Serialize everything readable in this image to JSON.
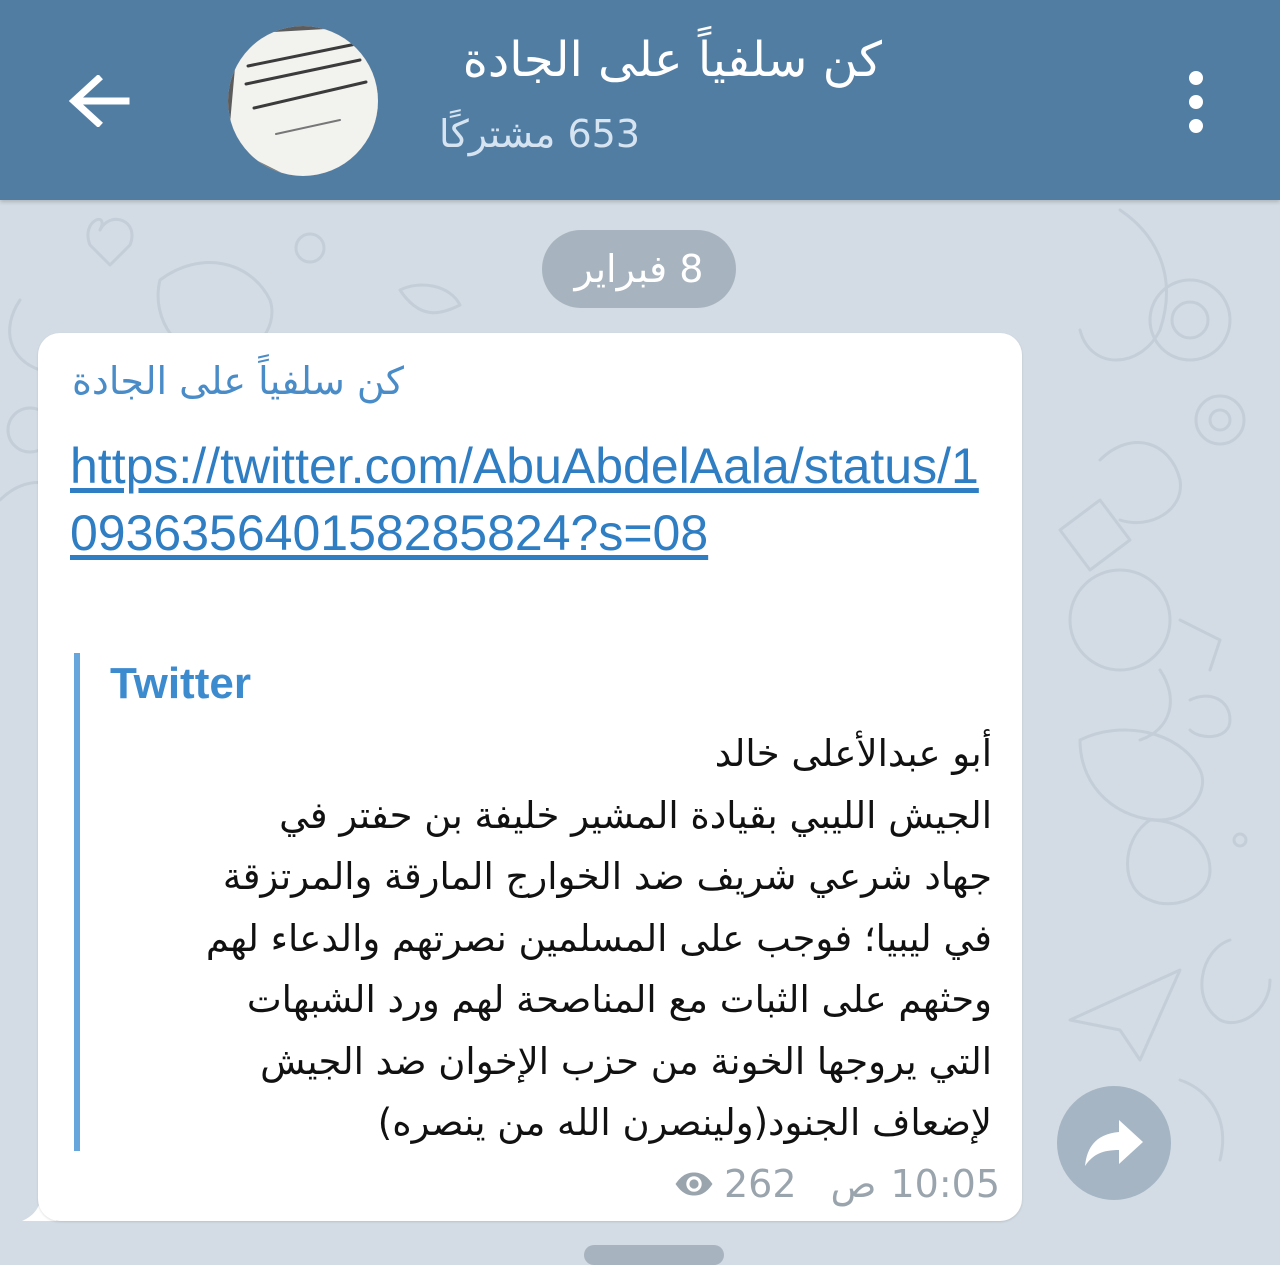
{
  "header": {
    "back_icon": "arrow-left-icon",
    "channel_title": "كن سلفياً على الجادة",
    "subscriber_count": "653 مشتركًا",
    "menu_icon": "more-vertical-icon",
    "header_color": "#527da3"
  },
  "chat": {
    "date_label": "8 فبراير",
    "background_color": "#d3dce4"
  },
  "message": {
    "sender": "كن سلفياً على الجادة",
    "link_text": "https://twitter.com/AbuAbdelAala/status/1093635640158285824?s=08",
    "preview": {
      "site_name": "Twitter",
      "body_lines": [
        "أبو عبدالأعلى خالد",
        "الجيش الليبي بقيادة المشير خليفة بن حفتر في",
        "جهاد شرعي شريف ضد الخوارج المارقة والمرتزقة",
        "في ليبيا؛ فوجب على المسلمين نصرتهم والدعاء لهم",
        "وحثهم على الثبات مع المناصحة لهم ورد الشبهات",
        "التي يروجها الخونة من حزب الإخوان ضد الجيش",
        "لإضعاف الجنود(ولينصرن الله من ينصره)"
      ]
    },
    "time": "10:05",
    "ampm": "ص",
    "views": "262",
    "views_icon": "eye-icon"
  },
  "share_icon": "share-arrow-icon"
}
